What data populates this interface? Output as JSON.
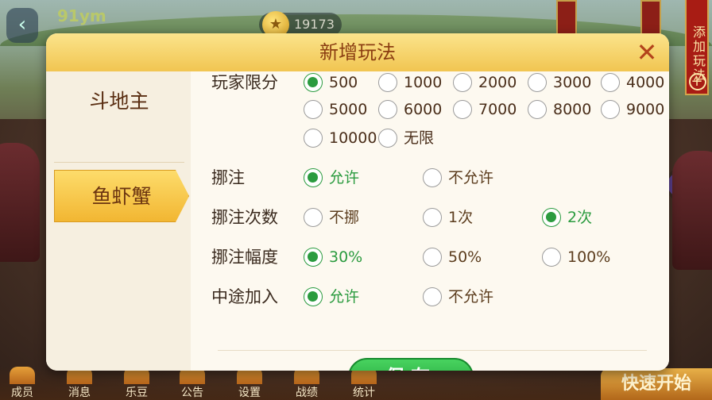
{
  "topbar": {
    "username": "91ym",
    "coins": "19173",
    "add_rule": "添加玩法"
  },
  "dialog": {
    "title": "新增玩法",
    "close": "✕"
  },
  "sidebar": {
    "items": [
      {
        "label": "斗地主"
      },
      {
        "label": "鱼虾蟹"
      }
    ]
  },
  "player_limit": {
    "label": "玩家限分",
    "row1": [
      "500",
      "1000",
      "2000",
      "3000",
      "4000"
    ],
    "row2": [
      "5000",
      "6000",
      "7000",
      "8000",
      "9000"
    ],
    "row3": [
      "10000",
      "无限"
    ],
    "selected": "500"
  },
  "settings": [
    {
      "label": "挪注",
      "options": [
        "允许",
        "不允许"
      ],
      "selected": "允许"
    },
    {
      "label": "挪注次数",
      "options": [
        "不挪",
        "1次",
        "2次"
      ],
      "selected": "2次"
    },
    {
      "label": "挪注幅度",
      "options": [
        "30%",
        "50%",
        "100%"
      ],
      "selected": "30%"
    },
    {
      "label": "中途加入",
      "options": [
        "允许",
        "不允许"
      ],
      "selected": "允许"
    }
  ],
  "save_label": "保存",
  "bottom_nav": [
    "成员",
    "消息",
    "乐豆",
    "公告",
    "设置",
    "战绩",
    "统计"
  ],
  "quick_start": "快速开始",
  "colors": {
    "accent_green": "#2b9b3f",
    "header_gold": "#f1c551",
    "title_brown": "#8b3e12"
  }
}
